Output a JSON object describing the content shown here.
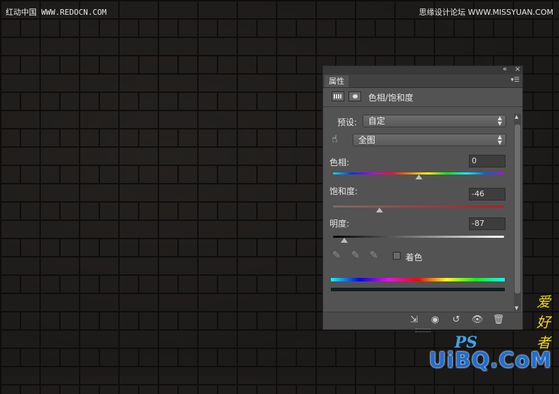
{
  "watermark": {
    "left": "红动中国 WWW.REDOCN.COM",
    "right": "思缘设计论坛 WWW.MISSYUAN.COM"
  },
  "logo": {
    "ps": "PS",
    "cn": "爱好者",
    "uibq": "UiBQ.CoM"
  },
  "panel": {
    "tab": "属性",
    "title": "色相/饱和度",
    "preset_label": "预设:",
    "preset_value": "自定",
    "channel_value": "全图",
    "hue_label": "色相:",
    "hue_value": "0",
    "hue_level": 0.5,
    "saturation_label": "饱和度:",
    "saturation_value": "-46",
    "saturation_level": 0.27,
    "lightness_label": "明度:",
    "lightness_value": "-87",
    "lightness_level": 0.065,
    "colorize_label": "着色"
  },
  "icons": {
    "collapse": "double-chevron-left-icon",
    "close": "close-icon",
    "menu": "panel-menu-icon",
    "adjustment": "adjustment-layer-icon",
    "mask": "layer-mask-icon",
    "hand": "targeted-adjustment-hand-icon",
    "eyedropper": "eyedropper-icon",
    "eyedropper_add": "eyedropper-add-icon",
    "eyedropper_sub": "eyedropper-subtract-icon",
    "clip": "clip-to-layer-icon",
    "view_previous": "view-previous-state-icon",
    "reset": "reset-icon",
    "visibility": "eye-icon",
    "delete": "trash-icon"
  },
  "colors": {
    "panel_bg": "#535353",
    "saturation_track": "#b21d1d",
    "lightness_track_end": "#ffffff"
  }
}
